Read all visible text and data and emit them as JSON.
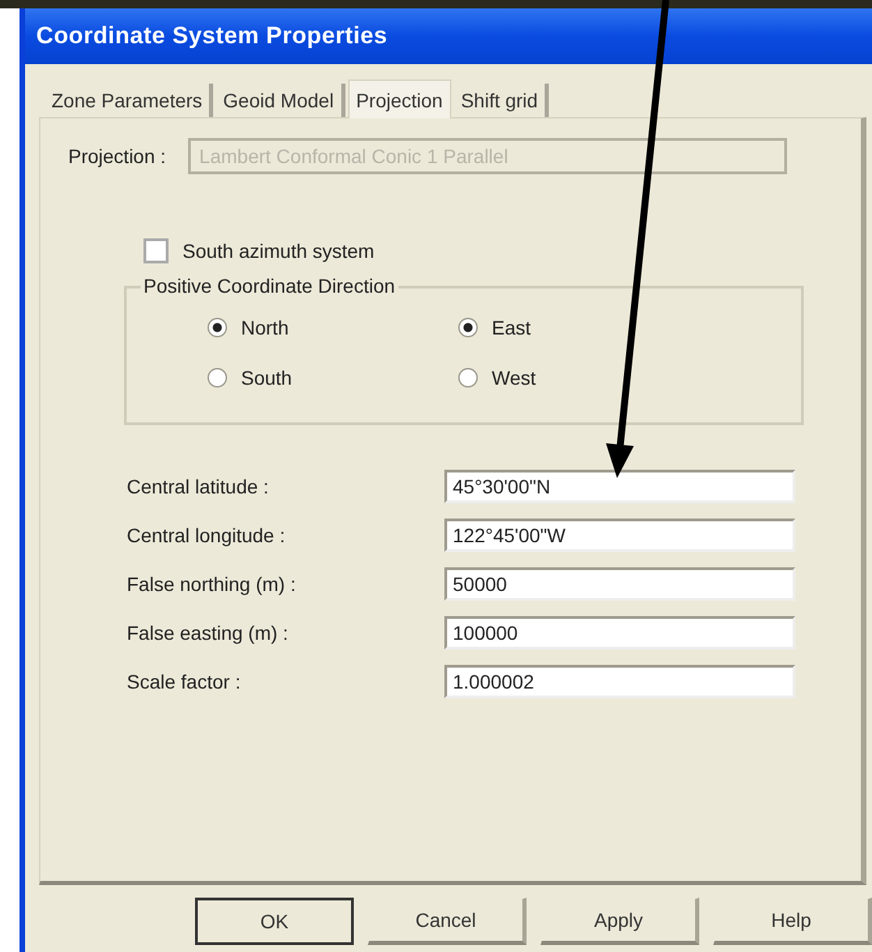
{
  "window": {
    "title": "Coordinate System Properties"
  },
  "tabs": [
    {
      "label": "Zone Parameters",
      "selected": false
    },
    {
      "label": "Geoid Model",
      "selected": false
    },
    {
      "label": "Projection",
      "selected": true
    },
    {
      "label": "Shift grid",
      "selected": false
    }
  ],
  "projection": {
    "label": "Projection :",
    "value": "Lambert Conformal Conic 1 Parallel",
    "disabled": true
  },
  "south_azimuth": {
    "label": "South azimuth system",
    "checked": false
  },
  "direction_group": {
    "title": "Positive Coordinate Direction",
    "options": [
      {
        "label": "North",
        "selected": true
      },
      {
        "label": "East",
        "selected": true
      },
      {
        "label": "South",
        "selected": false
      },
      {
        "label": "West",
        "selected": false
      }
    ]
  },
  "parameters": [
    {
      "label": "Central latitude :",
      "value": "45°30'00\"N"
    },
    {
      "label": "Central longitude :",
      "value": "122°45'00\"W"
    },
    {
      "label": "False northing  (m) :",
      "value": "50000"
    },
    {
      "label": "False easting  (m) :",
      "value": "100000"
    },
    {
      "label": "Scale factor :",
      "value": "1.000002"
    }
  ],
  "buttons": [
    {
      "label": "OK",
      "default": true
    },
    {
      "label": "Cancel",
      "default": false
    },
    {
      "label": "Apply",
      "default": false
    },
    {
      "label": "Help",
      "default": false
    }
  ]
}
